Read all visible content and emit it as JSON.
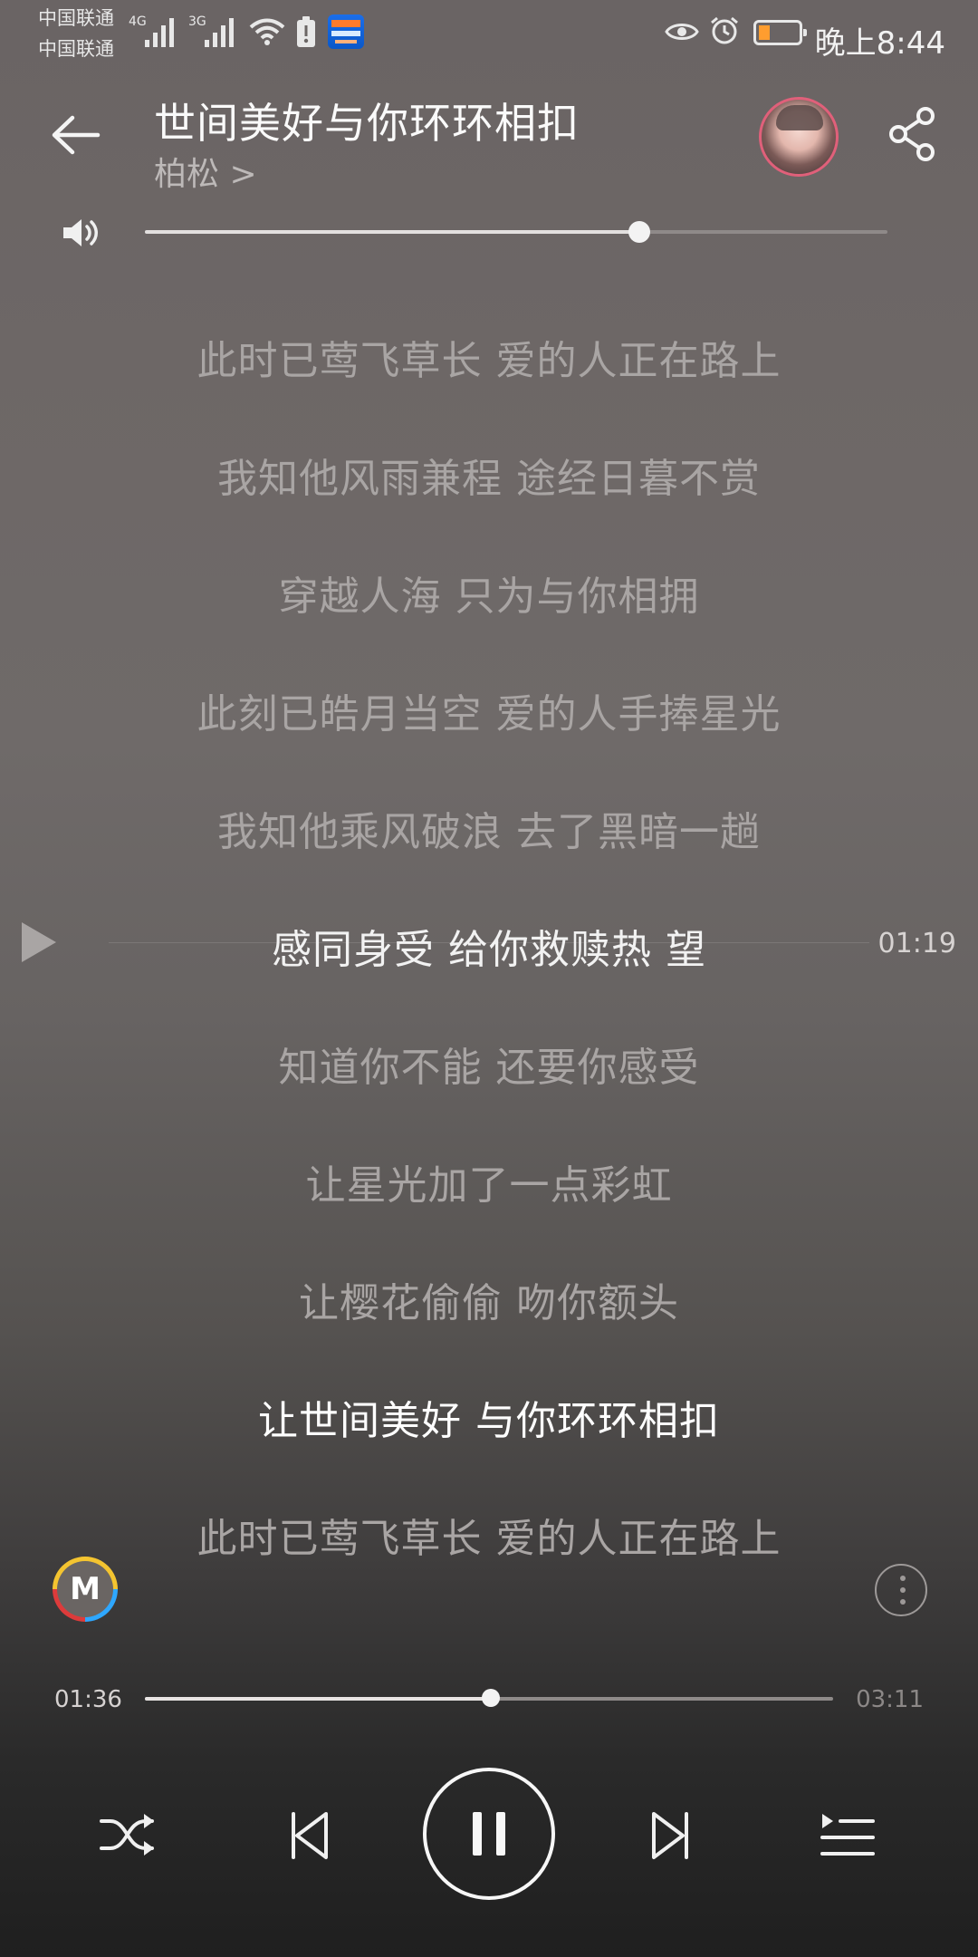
{
  "status_bar": {
    "carrier_1": "中国联通",
    "carrier_2": "中国联通",
    "network_1": "4G",
    "network_2": "3G",
    "time": "晚上8:44"
  },
  "header": {
    "title": "世间美好与你环环相扣",
    "artist": "柏松 >"
  },
  "player": {
    "volume_level": 0.67,
    "current_time": "01:36",
    "total_time": "03:11",
    "progress_fraction": 0.5,
    "marker_time": "01:19"
  },
  "lyrics": [
    {
      "text": "此时已莺飞草长 爱的人正在路上",
      "state": "normal"
    },
    {
      "text": "我知他风雨兼程 途经日暮不赏",
      "state": "normal"
    },
    {
      "text": "穿越人海 只为与你相拥",
      "state": "normal"
    },
    {
      "text": "此刻已皓月当空 爱的人手捧星光",
      "state": "normal"
    },
    {
      "text": "我知他乘风破浪 去了黑暗一趟",
      "state": "normal"
    },
    {
      "text": "感同身受 给你救赎热 望",
      "state": "current"
    },
    {
      "text": "知道你不能 还要你感受",
      "state": "normal"
    },
    {
      "text": "让星光加了一点彩虹",
      "state": "normal"
    },
    {
      "text": "让樱花偷偷 吻你额头",
      "state": "normal"
    },
    {
      "text": "让世间美好 与你环环相扣",
      "state": "active"
    },
    {
      "text": "此时已莺飞草长 爱的人正在路上",
      "state": "normal"
    }
  ],
  "brand": {
    "logo_letter": "M"
  },
  "icons": {
    "back": "back-arrow-icon",
    "share": "share-icon",
    "volume": "volume-icon",
    "play_marker": "play-icon",
    "more": "more-icon",
    "shuffle": "shuffle-icon",
    "previous": "previous-icon",
    "pause": "pause-icon",
    "next": "next-icon",
    "playlist": "playlist-icon"
  },
  "colors": {
    "accent": "#ffffff",
    "muted_text": "#a9a5a4"
  }
}
